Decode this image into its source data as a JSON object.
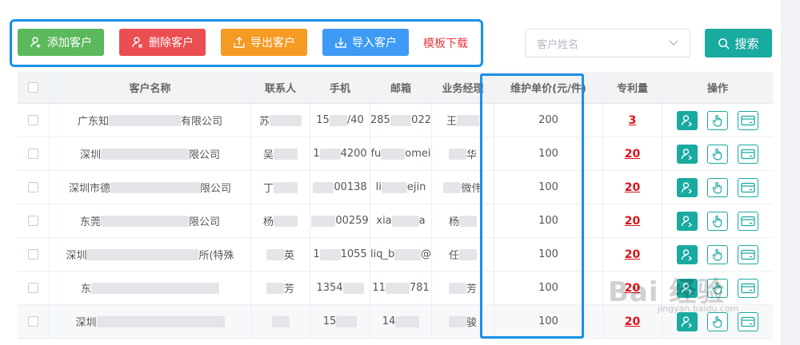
{
  "toolbar": {
    "add_label": "添加客户",
    "delete_label": "删除客户",
    "export_label": "导出客户",
    "import_label": "导入客户",
    "template_label": "模板下载"
  },
  "search": {
    "placeholder": "客户姓名",
    "button_label": "搜索"
  },
  "table": {
    "headers": {
      "name": "客户名称",
      "contact": "联系人",
      "phone": "手机",
      "email": "邮箱",
      "manager": "业务经理",
      "price": "维护单价(元/件)",
      "patents": "专利量",
      "actions": "操作"
    },
    "rows": [
      {
        "name_a": "广东知",
        "name_b": "有限公司",
        "contact_a": "苏",
        "contact_b": "",
        "phone_a": "15",
        "phone_b": "/40",
        "email_a": "285",
        "email_b": "022",
        "manager_a": "王",
        "manager_b": "",
        "price": "200",
        "patents": "3"
      },
      {
        "name_a": "深圳",
        "name_b": "限公司",
        "contact_a": "吴",
        "contact_b": "",
        "phone_a": "1",
        "phone_b": "4200",
        "email_a": "fu",
        "email_b": "omei",
        "manager_a": "",
        "manager_b": "华",
        "price": "100",
        "patents": "20"
      },
      {
        "name_a": "深圳市德",
        "name_b": "限公司",
        "contact_a": "丁",
        "contact_b": "",
        "phone_a": "",
        "phone_b": "00138",
        "email_a": "li",
        "email_b": "ejin",
        "manager_a": "",
        "manager_b": "微伟",
        "price": "100",
        "patents": "20"
      },
      {
        "name_a": "东莞",
        "name_b": "限公司",
        "contact_a": "杨",
        "contact_b": "",
        "phone_a": "",
        "phone_b": "00259",
        "email_a": "xia",
        "email_b": "a",
        "manager_a": "杨",
        "manager_b": "",
        "price": "100",
        "patents": "20"
      },
      {
        "name_a": "深圳",
        "name_b": "所(特殊",
        "contact_a": "",
        "contact_b": "英",
        "phone_a": "1",
        "phone_b": "1055",
        "email_a": "liq_b",
        "email_b": "@",
        "manager_a": "任",
        "manager_b": "",
        "price": "100",
        "patents": "20"
      },
      {
        "name_a": "东",
        "name_b": "",
        "contact_a": "",
        "contact_b": "芳",
        "phone_a": "1354",
        "phone_b": "",
        "email_a": "11",
        "email_b": "781",
        "manager_a": "",
        "manager_b": "芳",
        "price": "100",
        "patents": "20"
      },
      {
        "name_a": "深圳",
        "name_b": "",
        "contact_a": "",
        "contact_b": "",
        "phone_a": "15",
        "phone_b": "",
        "email_a": "14",
        "email_b": "",
        "manager_a": "",
        "manager_b": "骏",
        "price": "100",
        "patents": "20"
      }
    ]
  },
  "watermark": {
    "text": "Bai 经验",
    "sub": "jingyan.baidu.com"
  },
  "colors": {
    "add": "#5cb85c",
    "delete": "#ea4e51",
    "export": "#f59a23",
    "import": "#3e9bf5",
    "accent": "#19aaa0",
    "highlight": "#1a90e6",
    "patent_count": "#d7121a"
  }
}
